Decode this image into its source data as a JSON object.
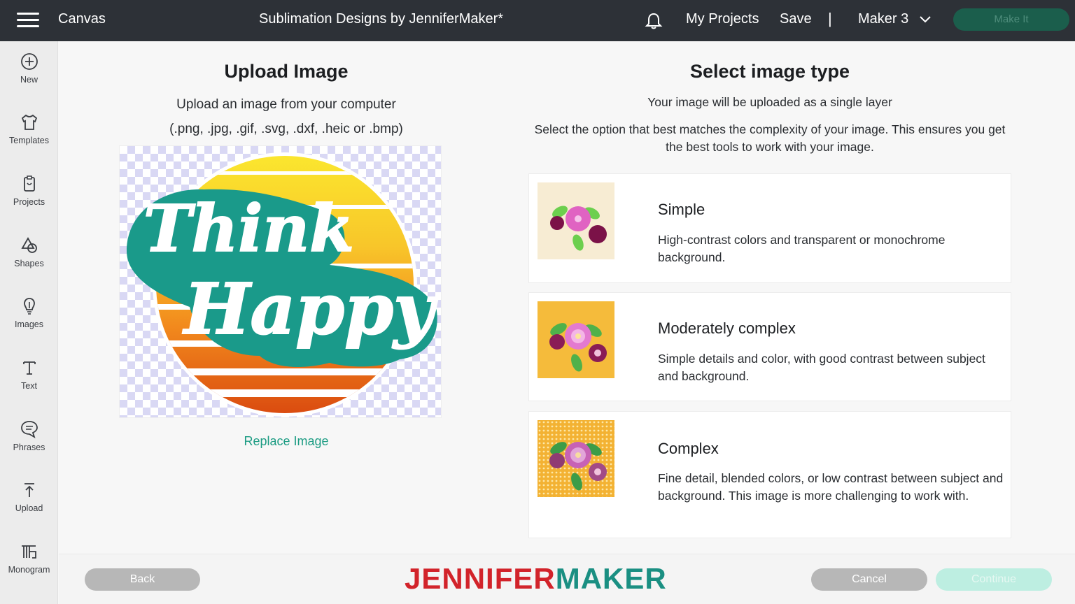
{
  "topbar": {
    "app_name": "Canvas",
    "project_title": "Sublimation Designs by JenniferMaker*",
    "my_projects": "My Projects",
    "save": "Save",
    "separator": "|",
    "machine": "Maker 3",
    "make_it": "Make It"
  },
  "sidebar": {
    "items": [
      {
        "label": "New",
        "icon": "plus-circle-icon"
      },
      {
        "label": "Templates",
        "icon": "shirt-icon"
      },
      {
        "label": "Projects",
        "icon": "clipboard-icon"
      },
      {
        "label": "Shapes",
        "icon": "shapes-icon"
      },
      {
        "label": "Images",
        "icon": "lightbulb-icon"
      },
      {
        "label": "Text",
        "icon": "text-icon"
      },
      {
        "label": "Phrases",
        "icon": "speech-bubble-icon"
      },
      {
        "label": "Upload",
        "icon": "upload-icon"
      },
      {
        "label": "Monogram",
        "icon": "monogram-icon"
      }
    ]
  },
  "upload": {
    "title": "Upload Image",
    "subtitle": "Upload an image from your computer",
    "formats": "(.png, .jpg, .gif, .svg, .dxf, .heic or .bmp)",
    "preview_word1": "Think",
    "preview_word2": "Happy",
    "replace": "Replace Image"
  },
  "image_type": {
    "title": "Select image type",
    "subtitle": "Your image will be uploaded as a single layer",
    "instructions": "Select the option that best matches the complexity of your image. This ensures you get the best tools to work with your image.",
    "options": [
      {
        "title": "Simple",
        "description": "High-contrast colors and transparent or monochrome background."
      },
      {
        "title": "Moderately complex",
        "description": "Simple details and color, with good contrast between subject and background."
      },
      {
        "title": "Complex",
        "description": "Fine detail, blended colors, or low contrast between subject and background. This image is more challenging to work with."
      }
    ]
  },
  "footer": {
    "back": "Back",
    "cancel": "Cancel",
    "continue": "Continue",
    "brand_part1": "JENNIFER",
    "brand_part2": "MAKER"
  },
  "colors": {
    "topbar": "#2d3137",
    "accent_green": "#1c9c83",
    "brand_red": "#d2232a",
    "brand_teal": "#1a8f82"
  }
}
